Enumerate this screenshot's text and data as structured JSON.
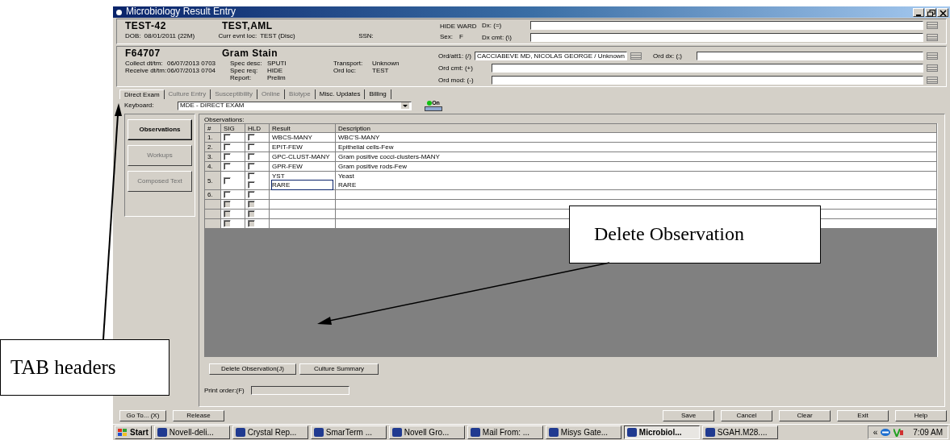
{
  "window": {
    "title": "Microbiology Result Entry"
  },
  "patient": {
    "id": "TEST-42",
    "name": "TEST,AML",
    "dob_label": "DOB:",
    "dob": "08/01/2011 (22M)",
    "loc_label": "Curr evnt loc:",
    "loc": "TEST (Disc)",
    "ssn_label": "SSN:",
    "ward": "HIDE WARD",
    "sex_label": "Sex:",
    "sex": "F",
    "fields": [
      {
        "label": "Dx: (=)"
      },
      {
        "label": "Dx cmt: (\\)"
      }
    ]
  },
  "order": {
    "number": "F64707",
    "test": "Gram Stain",
    "detail_columns": [
      [
        {
          "label": "Collect dt/tm:",
          "value": "06/07/2013 0703"
        },
        {
          "label": "Receive dt/tm:",
          "value": "06/07/2013 0704"
        }
      ],
      [
        {
          "label": "Spec desc:",
          "value": "SPUTI"
        },
        {
          "label": "Spec req:",
          "value": "HIDE"
        },
        {
          "label": "Report:",
          "value": "Prelim"
        }
      ],
      [
        {
          "label": "Transport:",
          "value": "Unknown"
        },
        {
          "label": "Ord loc:",
          "value": "TEST"
        }
      ]
    ],
    "attending": {
      "label": "Ord/att1: (/)",
      "value": "CACCIABEVE MD, NICOLAS GEORGE / Unknown"
    },
    "dx": {
      "label": "Ord dx: (;)"
    },
    "fields": [
      {
        "label": "Ord cmt: (+)"
      },
      {
        "label": "Ord mod: (-)"
      }
    ]
  },
  "tabs": [
    {
      "label": "Direct Exam",
      "selected": true,
      "disabled": false
    },
    {
      "label": "Culture Entry",
      "selected": false,
      "disabled": true
    },
    {
      "label": "Susceptibility",
      "selected": false,
      "disabled": true
    },
    {
      "label": "Online",
      "selected": false,
      "disabled": true
    },
    {
      "label": "Biotype",
      "selected": false,
      "disabled": true
    },
    {
      "label": "Misc. Updates",
      "selected": false,
      "disabled": false
    },
    {
      "label": "Billing",
      "selected": false,
      "disabled": false
    }
  ],
  "keyboard": {
    "label": "Keyboard:",
    "value": "MDE - DIRECT EXAM",
    "indicator": "On",
    "on": true
  },
  "side_buttons": [
    {
      "label": "Observations",
      "selected": true,
      "disabled": false
    },
    {
      "label": "Workups",
      "selected": false,
      "disabled": true
    },
    {
      "label": "Composed Text",
      "selected": false,
      "disabled": true
    }
  ],
  "observations": {
    "title": "Observations:",
    "columns": [
      "#",
      "SIG",
      "HLD",
      "Result",
      "Description"
    ],
    "rows": [
      {
        "number": "1.",
        "sig": false,
        "disabled": false,
        "lines": [
          {
            "hld": false,
            "result": "WBCS-MANY",
            "description": "WBC'S-MANY",
            "editing": false
          }
        ]
      },
      {
        "number": "2.",
        "sig": false,
        "disabled": false,
        "lines": [
          {
            "hld": false,
            "result": "EPIT-FEW",
            "description": "Epithelial cells-Few",
            "editing": false
          }
        ]
      },
      {
        "number": "3.",
        "sig": false,
        "disabled": false,
        "lines": [
          {
            "hld": false,
            "result": "GPC-CLUST-MANY",
            "description": "Gram positive cocci-clusters-MANY",
            "editing": false
          }
        ]
      },
      {
        "number": "4.",
        "sig": false,
        "disabled": false,
        "lines": [
          {
            "hld": false,
            "result": "GPR-FEW",
            "description": "Gram positive rods-Few",
            "editing": false
          }
        ]
      },
      {
        "number": "5.",
        "sig": false,
        "disabled": false,
        "lines": [
          {
            "hld": false,
            "result": "YST",
            "description": "Yeast",
            "editing": false
          },
          {
            "hld": false,
            "result": "RARE",
            "description": "RARE",
            "editing": true
          }
        ]
      },
      {
        "number": "6.",
        "sig": false,
        "disabled": false,
        "lines": [
          {
            "hld": false,
            "editing": false
          }
        ]
      },
      {
        "sig": false,
        "disabled": true,
        "lines": [
          {
            "hld": false,
            "editing": false
          }
        ]
      },
      {
        "sig": false,
        "disabled": true,
        "lines": [
          {
            "hld": false,
            "editing": false
          }
        ]
      },
      {
        "sig": false,
        "disabled": true,
        "lines": [
          {
            "hld": false,
            "editing": false
          }
        ]
      }
    ]
  },
  "panel_buttons": [
    "Delete Observation(J)",
    "Culture Summary"
  ],
  "print_order": {
    "label": "Print order:(F)"
  },
  "left_buttons": [
    "Go To... (X)",
    "Release"
  ],
  "right_buttons": [
    "Save",
    "Cancel",
    "Clear",
    "Exit",
    "Help"
  ],
  "taskbar": {
    "start": "Start",
    "items": [
      {
        "label": "Novell-deli...",
        "selected": false
      },
      {
        "label": "Crystal Rep...",
        "selected": false
      },
      {
        "label": "SmarTerm ...",
        "selected": false
      },
      {
        "label": "Novell Gro...",
        "selected": false
      },
      {
        "label": "Mail From: ...",
        "selected": false
      },
      {
        "label": "Misys Gate...",
        "selected": false
      },
      {
        "label": "Microbiol...",
        "selected": true
      },
      {
        "label": "SGAH.M28....",
        "selected": false
      }
    ],
    "tray_toggle": "«",
    "clock": "7:09 AM"
  },
  "annotations": [
    {
      "text": "TAB headers"
    },
    {
      "text": "Delete Observation"
    }
  ]
}
